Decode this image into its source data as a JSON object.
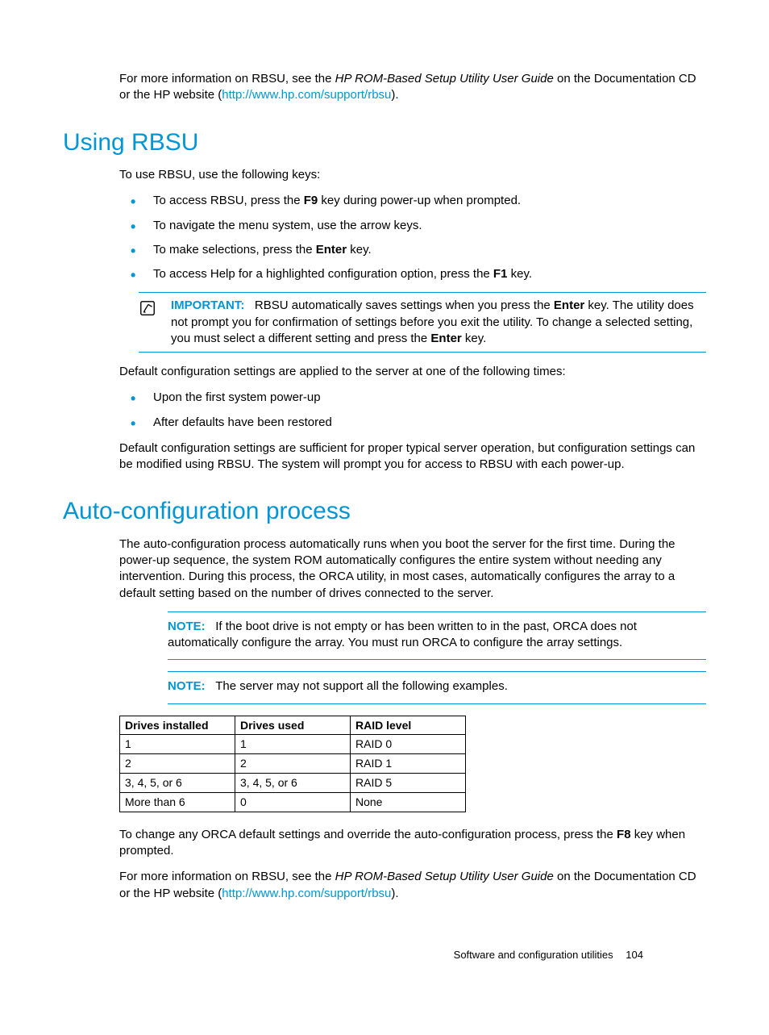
{
  "intro": {
    "prefix": "For more information on RBSU, see the ",
    "italic": "HP ROM-Based Setup Utility User Guide",
    "mid": " on the Documentation CD or the HP website (",
    "link": "http://www.hp.com/support/rbsu",
    "suffix": ")."
  },
  "section1": {
    "heading": "Using RBSU",
    "lead": "To use RBSU, use the following keys:",
    "bullets": {
      "b1": {
        "a": "To access RBSU, press the ",
        "bold": "F9",
        "b": " key during power-up when prompted."
      },
      "b2": {
        "a": "To navigate the menu system, use the arrow keys."
      },
      "b3": {
        "a": "To make selections, press the ",
        "bold": "Enter",
        "b": " key."
      },
      "b4": {
        "a": "To access Help for a highlighted configuration option, press the ",
        "bold": "F1",
        "b": " key."
      }
    },
    "important": {
      "label": "IMPORTANT:",
      "t1": "RBSU automatically saves settings when you press the ",
      "bold1": "Enter",
      "t2": " key. The utility does not prompt you for confirmation of settings before you exit the utility. To change a selected setting, you must select a different setting and press the ",
      "bold2": "Enter",
      "t3": " key."
    },
    "para2": "Default configuration settings are applied to the server at one of the following times:",
    "bullets2": {
      "b1": "Upon the first system power-up",
      "b2": "After defaults have been restored"
    },
    "para3": "Default configuration settings are sufficient for proper typical server operation, but configuration settings can be modified using RBSU. The system will prompt you for access to RBSU with each power-up."
  },
  "section2": {
    "heading": "Auto-configuration process",
    "para1": "The auto-configuration process automatically runs when you boot the server for the first time. During the power-up sequence, the system ROM automatically configures the entire system without needing any intervention. During this process, the ORCA utility, in most cases, automatically configures the array to a default setting based on the number of drives connected to the server.",
    "note1": {
      "label": "NOTE:",
      "text": "If the boot drive is not empty or has been written to in the past, ORCA does not automatically configure the array. You must run ORCA to configure the array settings."
    },
    "note2": {
      "label": "NOTE:",
      "text": "The server may not support all the following examples."
    },
    "table": {
      "headers": {
        "h1": "Drives installed",
        "h2": "Drives used",
        "h3": "RAID level"
      },
      "rows": [
        {
          "c1": "1",
          "c2": "1",
          "c3": "RAID 0"
        },
        {
          "c1": "2",
          "c2": "2",
          "c3": "RAID 1"
        },
        {
          "c1": "3, 4, 5, or 6",
          "c2": "3, 4, 5, or 6",
          "c3": "RAID 5"
        },
        {
          "c1": "More than 6",
          "c2": "0",
          "c3": "None"
        }
      ]
    },
    "para2": {
      "a": "To change any ORCA default settings and override the auto-configuration process, press the ",
      "bold": "F8",
      "b": " key when prompted."
    },
    "para3": {
      "prefix": "For more information on RBSU, see the ",
      "italic": "HP ROM-Based Setup Utility User Guide",
      "mid": " on the Documentation CD or the HP website (",
      "link": "http://www.hp.com/support/rbsu",
      "suffix": ")."
    }
  },
  "footer": {
    "section": "Software and configuration utilities",
    "page": "104"
  }
}
